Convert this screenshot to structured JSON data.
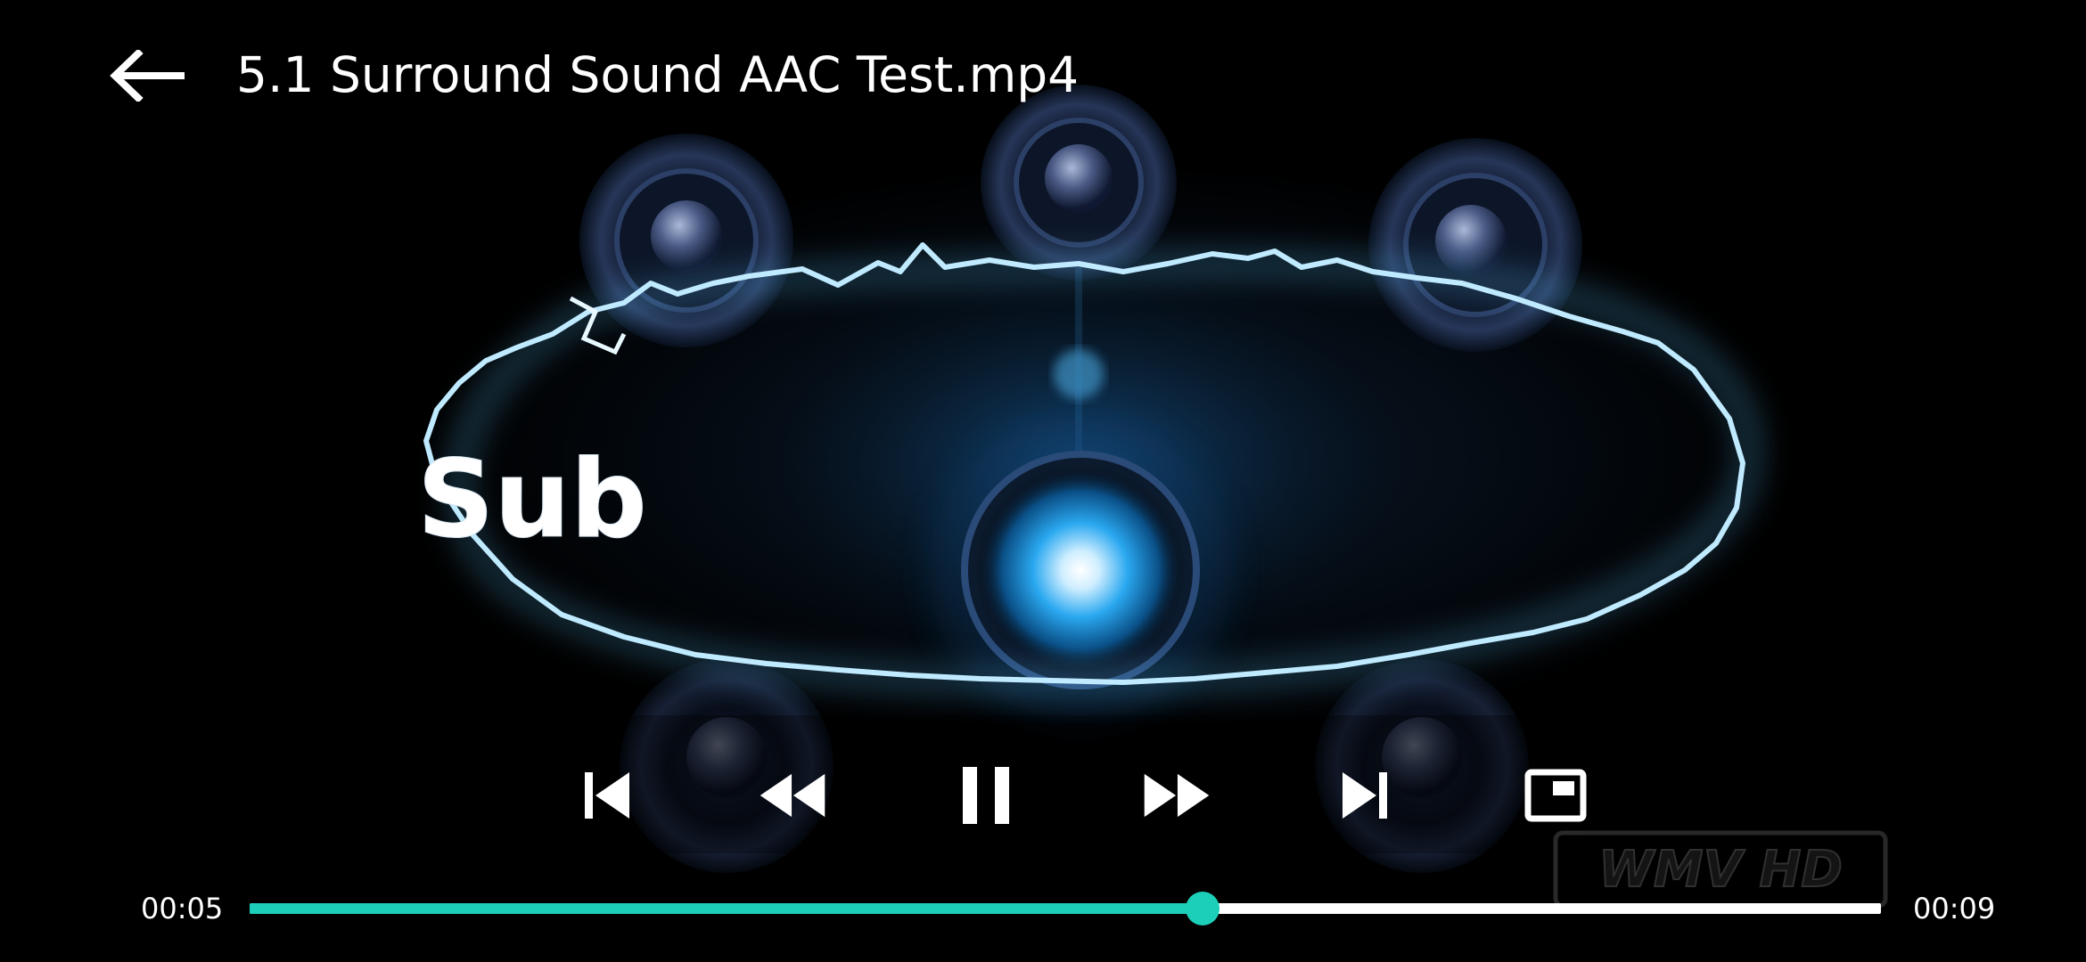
{
  "header": {
    "title": "5.1 Surround Sound AAC Test.mp4",
    "back_icon": "arrow-left-icon"
  },
  "video": {
    "channel_label": "Sub",
    "watermark_text": "WMV HD"
  },
  "controls": [
    {
      "name": "skip-previous-button",
      "icon": "skip-previous-icon"
    },
    {
      "name": "rewind-button",
      "icon": "rewind-icon"
    },
    {
      "name": "pause-button",
      "icon": "pause-icon"
    },
    {
      "name": "fast-forward-button",
      "icon": "fast-forward-icon"
    },
    {
      "name": "skip-next-button",
      "icon": "skip-next-icon"
    },
    {
      "name": "picture-in-picture-button",
      "icon": "picture-in-picture-icon"
    }
  ],
  "playback": {
    "current_time": "00:05",
    "duration": "00:09",
    "progress": 0.584
  },
  "colors": {
    "accent": "#1ccfb9",
    "background": "#000000",
    "glow": "#6fd6ff"
  }
}
